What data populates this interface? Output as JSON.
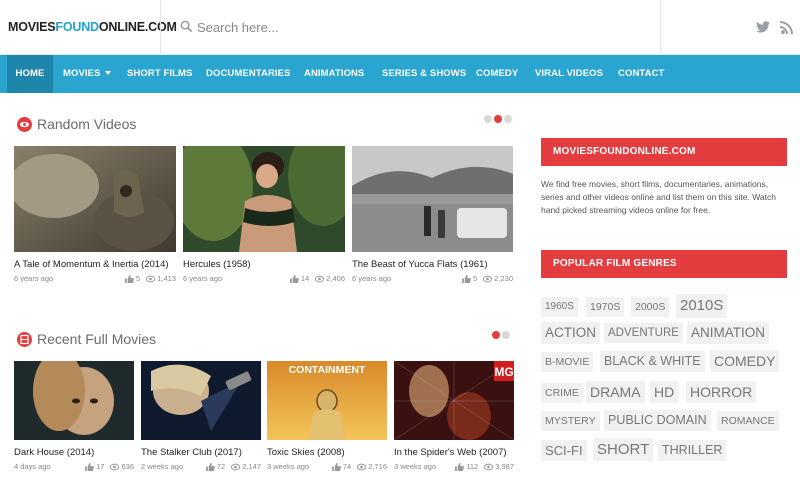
{
  "header": {
    "logo_part1": "MOVIES",
    "logo_part2": "FOUND",
    "logo_part3": "ONLINE.COM",
    "search_placeholder": "Search here..."
  },
  "nav": {
    "items": [
      "HOME",
      "MOVIES",
      "SHORT FILMS",
      "DOCUMENTARIES",
      "ANIMATIONS",
      "SERIES & SHOWS",
      "COMEDY",
      "VIRAL VIDEOS",
      "CONTACT"
    ],
    "active": "HOME"
  },
  "random_videos": {
    "title": "Random Videos",
    "items": [
      {
        "title": "A Tale of Momentum & Inertia (2014)",
        "age": "6 years ago",
        "likes": "5",
        "views": "1,413"
      },
      {
        "title": "Hercules (1958)",
        "age": "6 years ago",
        "likes": "14",
        "views": "2,406"
      },
      {
        "title": "The Beast of Yucca Flats (1961)",
        "age": "6 years ago",
        "likes": "5",
        "views": "2,230"
      }
    ]
  },
  "recent_movies": {
    "title": "Recent Full Movies",
    "items": [
      {
        "title": "Dark House (2014)",
        "age": "4 days ago",
        "likes": "17",
        "views": "636"
      },
      {
        "title": "The Stalker Club (2017)",
        "age": "2 weeks ago",
        "likes": "72",
        "views": "2,147"
      },
      {
        "title": "Toxic Skies (2008)",
        "age": "3 weeks ago",
        "likes": "74",
        "views": "2,716"
      },
      {
        "title": "In the Spider's Web (2007)",
        "age": "3 weeks ago",
        "likes": "112",
        "views": "3,987"
      }
    ],
    "poster_text": "CONTAINMENT",
    "poster_badge": "MG"
  },
  "sidebar": {
    "about_title": "MOVIESFOUNDONLINE.COM",
    "about_text": "We find free movies, short films, documentaries, animations, series and other videos online and list them on this site. Watch hand picked streaming videos online for free.",
    "genres_title": "POPULAR FILM GENRES",
    "genres": [
      "1960s",
      "1970s",
      "2000s",
      "2010s",
      "ACTION",
      "ADVENTURE",
      "ANIMATION",
      "B-MOVIE",
      "BLACK & WHITE",
      "COMEDY",
      "CRIME",
      "DRAMA",
      "HD",
      "HORROR",
      "MYSTERY",
      "PUBLIC DOMAIN",
      "ROMANCE",
      "SCI-FI",
      "SHORT",
      "THRILLER"
    ]
  },
  "colors": {
    "accent_red": "#e43d40",
    "nav_blue": "#2aa5cf",
    "nav_active": "#1e86ab"
  }
}
